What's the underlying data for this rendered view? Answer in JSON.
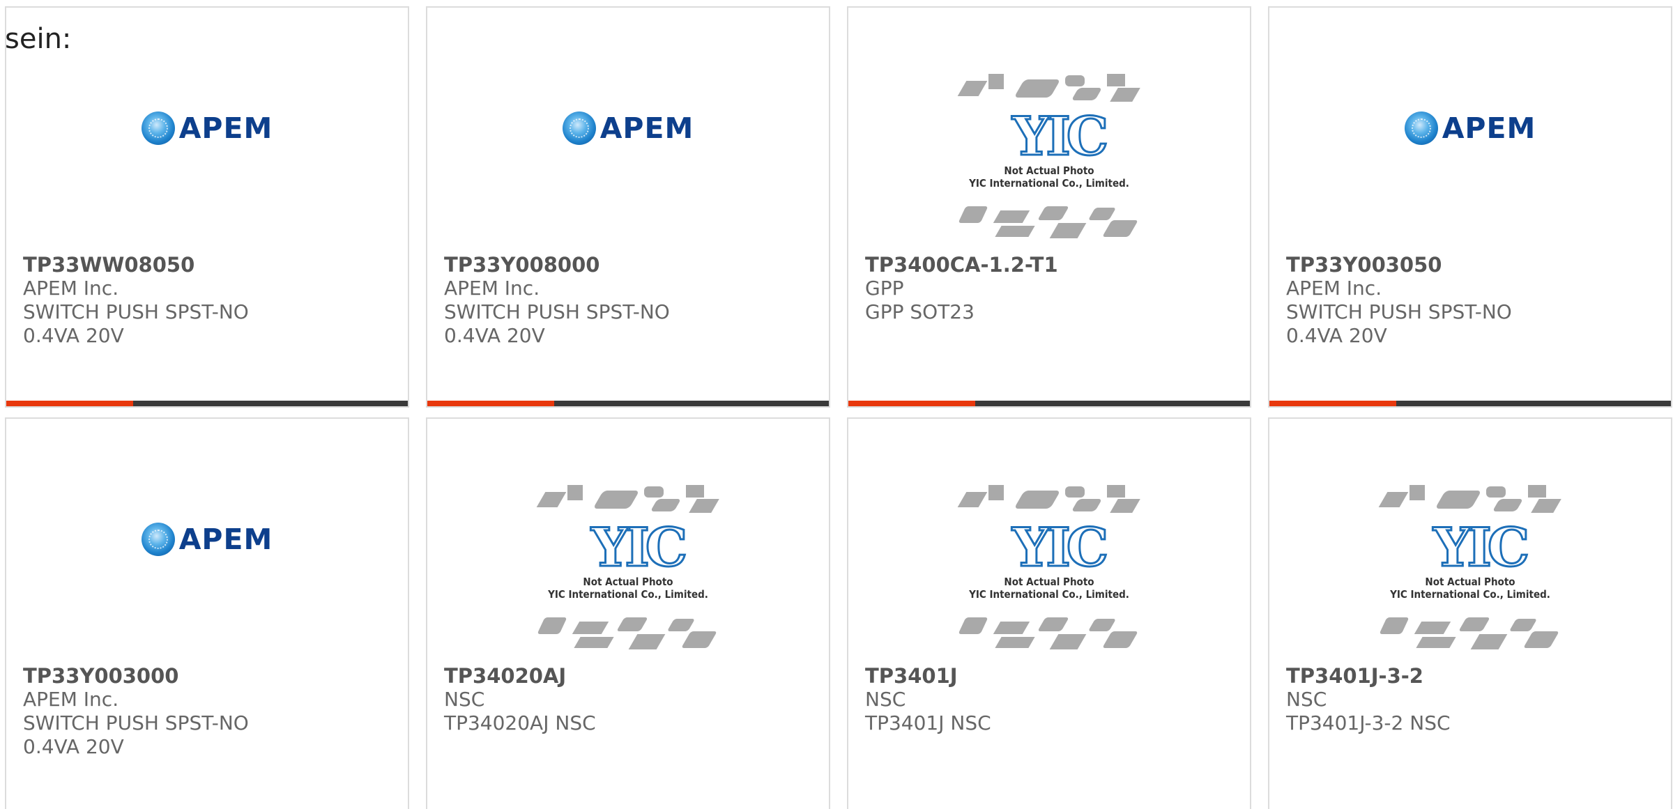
{
  "intro_text": "sein:",
  "accent_color": "#e8380d",
  "bar_color": "#3a3a3a",
  "placeholder": {
    "line1": "Not Actual Photo",
    "line2": "YIC International Co., Limited."
  },
  "products": [
    {
      "part": "TP33WW08050",
      "manufacturer": "APEM Inc.",
      "description": "SWITCH PUSH SPST-NO 0.4VA 20V",
      "image": "apem-logo"
    },
    {
      "part": "TP33Y008000",
      "manufacturer": "APEM Inc.",
      "description": "SWITCH PUSH SPST-NO 0.4VA 20V",
      "image": "apem-logo"
    },
    {
      "part": "TP3400CA-1.2-T1",
      "manufacturer": "GPP",
      "description": "GPP SOT23",
      "image": "yic-placeholder"
    },
    {
      "part": "TP33Y003050",
      "manufacturer": "APEM Inc.",
      "description": "SWITCH PUSH SPST-NO 0.4VA 20V",
      "image": "apem-logo"
    },
    {
      "part": "TP33Y003000",
      "manufacturer": "APEM Inc.",
      "description": "SWITCH PUSH SPST-NO 0.4VA 20V",
      "image": "apem-logo"
    },
    {
      "part": "TP34020AJ",
      "manufacturer": "NSC",
      "description": "TP34020AJ NSC",
      "image": "yic-placeholder"
    },
    {
      "part": "TP3401J",
      "manufacturer": "NSC",
      "description": "TP3401J NSC",
      "image": "yic-placeholder"
    },
    {
      "part": "TP3401J-3-2",
      "manufacturer": "NSC",
      "description": "TP3401J-3-2 NSC",
      "image": "yic-placeholder"
    }
  ],
  "apem_logo_text": "APEM",
  "yic_logo_text": "YIC"
}
